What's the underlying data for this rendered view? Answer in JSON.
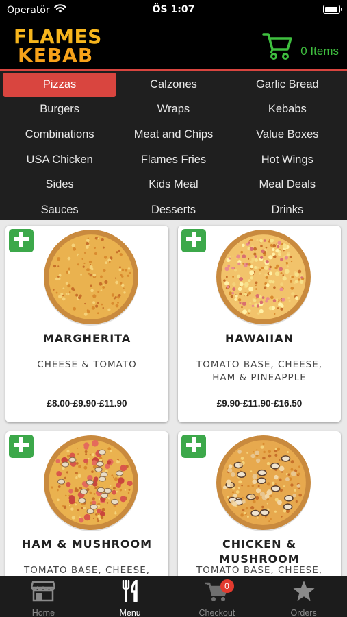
{
  "status_bar": {
    "carrier": "Operatör",
    "time": "ÖS 1:07",
    "battery_level": 0.9
  },
  "header": {
    "logo_line1": "FLAMES",
    "logo_line2": "KEBAB",
    "cart_count": "0 Items",
    "cart_icon": "shopping-cart-icon"
  },
  "categories": [
    {
      "label": "Pizzas",
      "active": true
    },
    {
      "label": "Calzones"
    },
    {
      "label": "Garlic Bread"
    },
    {
      "label": "Burgers"
    },
    {
      "label": "Wraps"
    },
    {
      "label": "Kebabs"
    },
    {
      "label": "Combinations"
    },
    {
      "label": "Meat and Chips"
    },
    {
      "label": "Value Boxes"
    },
    {
      "label": "USA Chicken"
    },
    {
      "label": "Flames Fries"
    },
    {
      "label": "Hot Wings"
    },
    {
      "label": "Sides"
    },
    {
      "label": "Kids Meal"
    },
    {
      "label": "Meal Deals"
    },
    {
      "label": "Sauces"
    },
    {
      "label": "Desserts"
    },
    {
      "label": "Drinks"
    }
  ],
  "products": [
    {
      "name": "MARGHERITA",
      "description": "CHEESE & TOMATO",
      "price": "£8.00-£9.90-£11.90",
      "topping": "cheese"
    },
    {
      "name": "HAWAIIAN",
      "description": "TOMATO BASE, CHEESE, HAM & PINEAPPLE",
      "price": "£9.90-£11.90-£16.50",
      "topping": "hawaiian"
    },
    {
      "name": "HAM & MUSHROOM",
      "description": "TOMATO BASE, CHEESE,",
      "price": "",
      "topping": "ham-mushroom"
    },
    {
      "name": "CHICKEN & MUSHROOM",
      "description": "TOMATO BASE, CHEESE,",
      "price": "",
      "topping": "chicken-mushroom"
    }
  ],
  "tabbar": {
    "tabs": [
      {
        "label": "Home",
        "icon": "store-icon"
      },
      {
        "label": "Menu",
        "icon": "fork-knife-icon",
        "active": true
      },
      {
        "label": "Checkout",
        "icon": "cart-icon",
        "badge": "0"
      },
      {
        "label": "Orders",
        "icon": "star-icon"
      }
    ]
  },
  "colors": {
    "accent": "#d9453f",
    "cart_green": "#3fbf3f",
    "add_green": "#3ca84a",
    "logo_yellow": "#f6b51d"
  }
}
